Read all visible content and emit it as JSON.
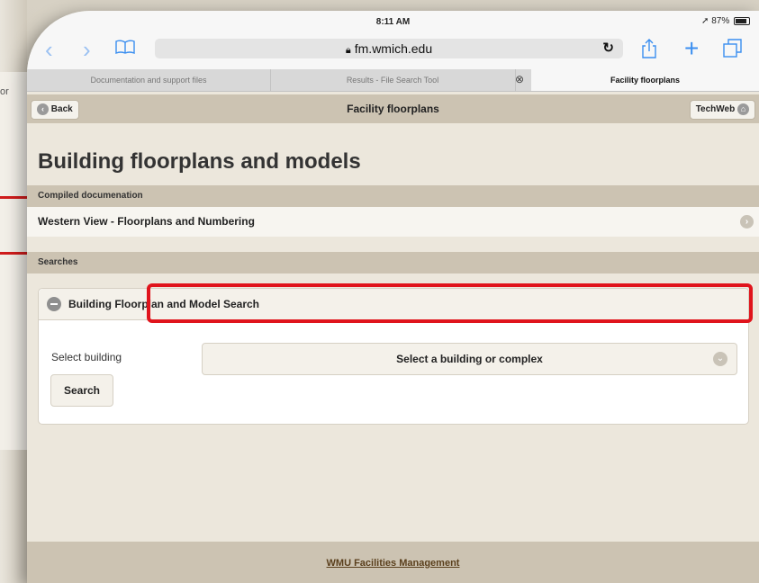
{
  "background": {
    "partial_text": "or"
  },
  "status_bar": {
    "time": "8:11 AM",
    "battery": "87%"
  },
  "browser": {
    "url": "fm.wmich.edu",
    "tabs": [
      {
        "label": "Documentation and support files"
      },
      {
        "label": "Results - File Search Tool"
      },
      {
        "label": "Facility floorplans"
      }
    ]
  },
  "topbar": {
    "back_label": "Back",
    "title": "Facility floorplans",
    "techweb_label": "TechWeb"
  },
  "page": {
    "heading": "Building floorplans and models",
    "compiled_section": "Compiled documenation",
    "compiled_item": "Western View - Floorplans and Numbering",
    "searches_section": "Searches",
    "panel_title": "Building Floorplan and Model Search",
    "select_label": "Select building",
    "select_placeholder": "Select a building or complex",
    "search_button": "Search",
    "footer_link": "WMU Facilities Management"
  },
  "colors": {
    "accent": "#ccc3b2",
    "highlight": "#e0141c",
    "ios_blue": "#3a8ef0"
  }
}
